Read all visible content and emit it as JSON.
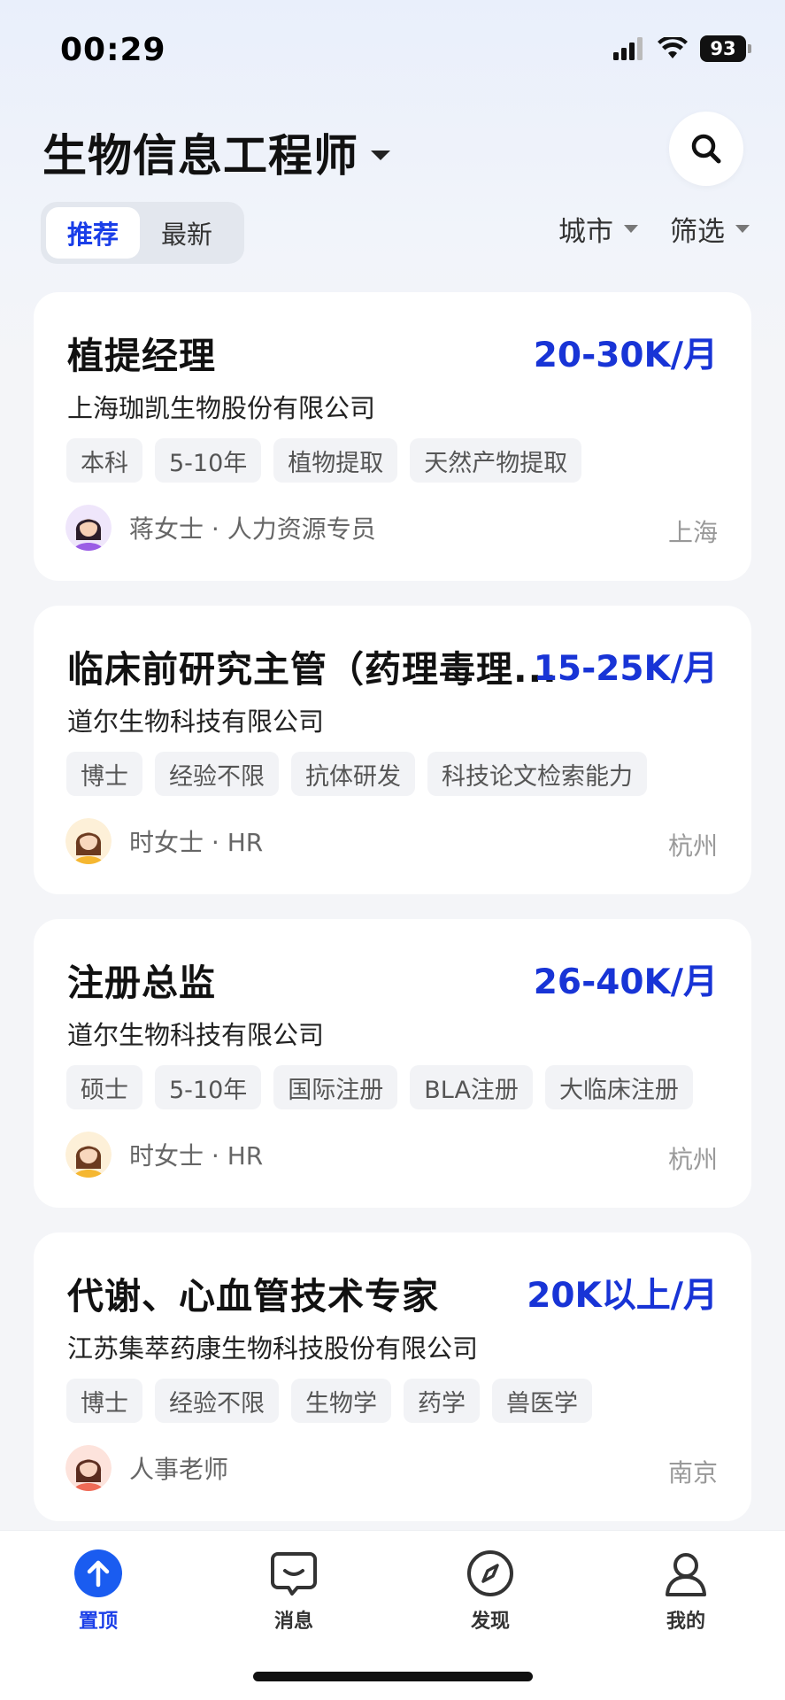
{
  "status_bar": {
    "time": "00:29",
    "battery": "93"
  },
  "header": {
    "title": "生物信息工程师"
  },
  "tabs": [
    {
      "label": "推荐",
      "active": true
    },
    {
      "label": "最新",
      "active": false
    }
  ],
  "filters": {
    "city_label": "城市",
    "filter_label": "筛选"
  },
  "jobs": [
    {
      "title": "植提经理",
      "salary": "20-30K/月",
      "company": "上海珈凯生物股份有限公司",
      "tags": [
        "本科",
        "5-10年",
        "植物提取",
        "天然产物提取"
      ],
      "recruiter": "蒋女士 · 人力资源专员",
      "city": "上海",
      "avatar": "woman-avatar-purple"
    },
    {
      "title": "临床前研究主管（药理毒理...",
      "salary": "15-25K/月",
      "company": "道尔生物科技有限公司",
      "tags": [
        "博士",
        "经验不限",
        "抗体研发",
        "科技论文检索能力"
      ],
      "recruiter": "时女士 · HR",
      "city": "杭州",
      "avatar": "woman-avatar-yellow"
    },
    {
      "title": "注册总监",
      "salary": "26-40K/月",
      "company": "道尔生物科技有限公司",
      "tags": [
        "硕士",
        "5-10年",
        "国际注册",
        "BLA注册",
        "大临床注册"
      ],
      "recruiter": "时女士 · HR",
      "city": "杭州",
      "avatar": "woman-avatar-yellow"
    },
    {
      "title": "代谢、心血管技术专家",
      "salary": "20K以上/月",
      "company": "江苏集萃药康生物科技股份有限公司",
      "tags": [
        "博士",
        "经验不限",
        "生物学",
        "药学",
        "兽医学"
      ],
      "recruiter": "人事老师",
      "city": "南京",
      "avatar": "woman-avatar-pink"
    }
  ],
  "tabbar": [
    {
      "label": "置顶",
      "icon": "arrow-up-circle-icon",
      "active": true
    },
    {
      "label": "消息",
      "icon": "chat-bubble-icon",
      "active": false
    },
    {
      "label": "发现",
      "icon": "compass-icon",
      "active": false
    },
    {
      "label": "我的",
      "icon": "person-icon",
      "active": false
    }
  ],
  "colors": {
    "accent": "#1a3ee8",
    "salary": "#1834d6",
    "background": "#f4f5f8"
  }
}
